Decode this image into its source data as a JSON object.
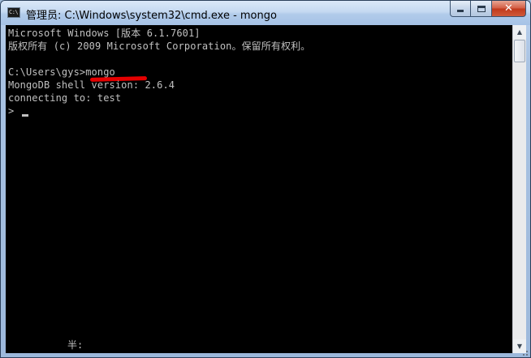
{
  "window": {
    "title": "管理员: C:\\Windows\\system32\\cmd.exe - mongo",
    "app_icon_text": "C:\\",
    "controls": {
      "minimize_icon": "minimize-icon",
      "maximize_icon": "maximize-icon",
      "close_icon": "close-icon",
      "close_glyph": "✕"
    }
  },
  "console": {
    "lines": [
      "Microsoft Windows [版本 6.1.7601]",
      "版权所有 (c) 2009 Microsoft Corporation。保留所有权利。",
      "",
      "C:\\Users\\gys>mongo",
      "MongoDB shell version: 2.6.4",
      "connecting to: test",
      ">"
    ],
    "ime_status": "半:",
    "highlight_color": "#e50000",
    "text_color": "#c0c0c0",
    "background_color": "#000000"
  },
  "scrollbar": {
    "up_arrow": "▲",
    "down_arrow": "▼"
  }
}
